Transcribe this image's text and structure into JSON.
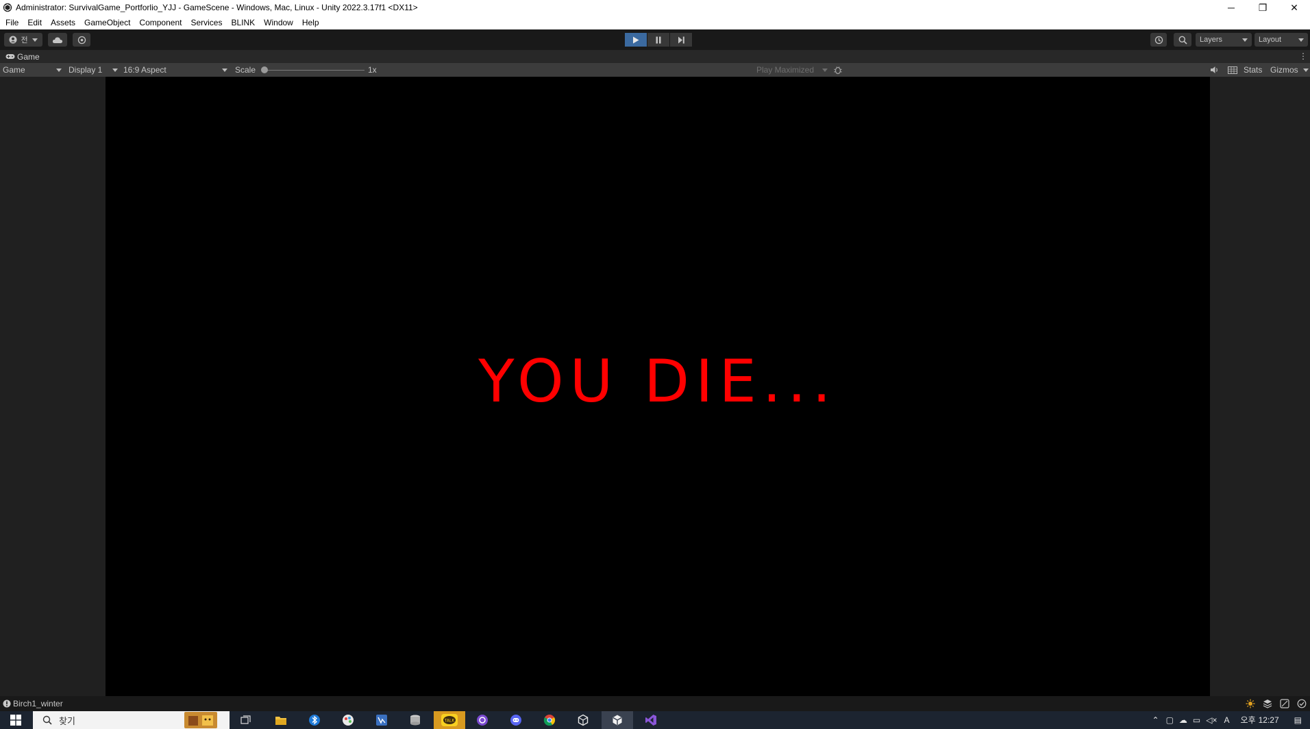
{
  "window": {
    "title": "Administrator: SurvivalGame_Portforlio_YJJ - GameScene - Windows, Mac, Linux - Unity 2022.3.17f1 <DX11>",
    "minimize_glyph": "─",
    "restore_glyph": "❐",
    "close_glyph": "✕"
  },
  "menu": [
    "File",
    "Edit",
    "Assets",
    "GameObject",
    "Component",
    "Services",
    "BLINK",
    "Window",
    "Help"
  ],
  "toolbar": {
    "account_label": "전",
    "layers_label": "Layers",
    "layout_label": "Layout",
    "play_active": true,
    "accent_color": "#3b6aa0"
  },
  "game_tab": {
    "label": "Game"
  },
  "game_controls": {
    "view_mode": "Game",
    "display": "Display 1",
    "aspect": "16:9 Aspect",
    "scale_label": "Scale",
    "scale_value": "1x",
    "play_mode": "Play Maximized",
    "stats_label": "Stats",
    "gizmos_label": "Gizmos"
  },
  "game_view": {
    "message": "YOU DIE...",
    "message_color": "#ff0000",
    "background_color": "#000000"
  },
  "status_bar": {
    "message": "Birch1_winter"
  },
  "taskbar": {
    "search_placeholder": "찾기",
    "time_period": "오후",
    "time": "12:27",
    "ime_label": "A",
    "apps": [
      "widget-icon",
      "task-view-icon",
      "file-explorer-icon",
      "bluetooth-app-icon",
      "paint-app-icon",
      "code-editor-icon",
      "database-icon",
      "kakaotalk-icon",
      "github-desktop-icon",
      "discord-icon",
      "chrome-icon",
      "unity-hub-icon",
      "unity-icon",
      "visual-studio-icon"
    ]
  }
}
